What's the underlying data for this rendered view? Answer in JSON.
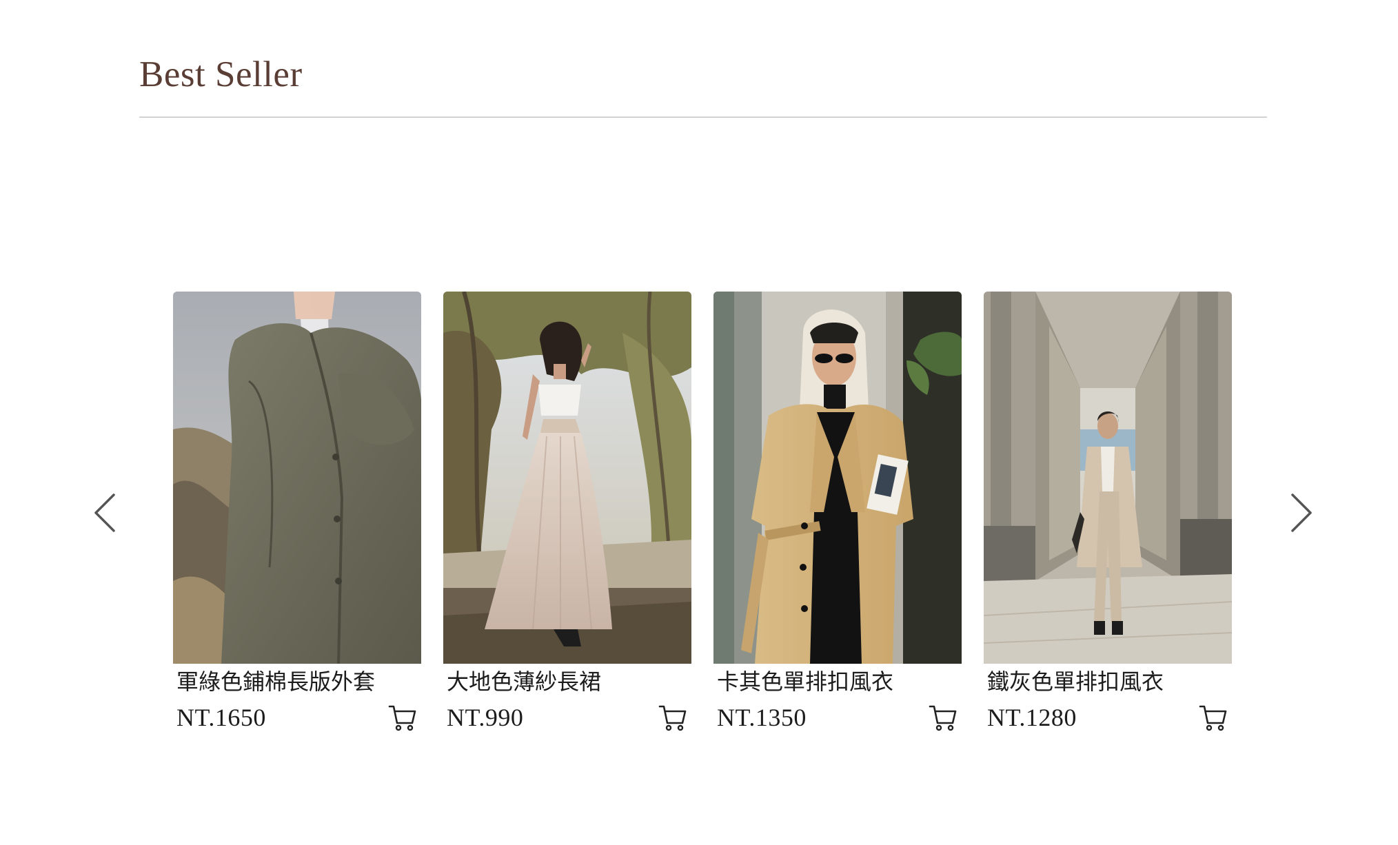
{
  "section": {
    "title": "Best Seller"
  },
  "navigation": {
    "prev_icon": "chevron-left-icon",
    "next_icon": "chevron-right-icon"
  },
  "products": [
    {
      "name": "軍綠色鋪棉長版外套",
      "price": "NT.1650",
      "photo": "model in olive-green padded long coat"
    },
    {
      "name": "大地色薄紗長裙",
      "price": "NT.990",
      "photo": "model in white crop top and tulle maxi skirt under trees"
    },
    {
      "name": "卡其色單排扣風衣",
      "price": "NT.1350",
      "photo": "model in khaki trench coat with headscarf and sunglasses"
    },
    {
      "name": "鐵灰色單排扣風衣",
      "price": "NT.1280",
      "photo": "model in trench coat in stone colonnade"
    }
  ],
  "colors": {
    "title": "#5a3e36",
    "divider": "#d2d2d2",
    "text": "#1c1c1c",
    "arrow": "#555555"
  },
  "icons": {
    "cart": "shopping-cart-icon"
  }
}
